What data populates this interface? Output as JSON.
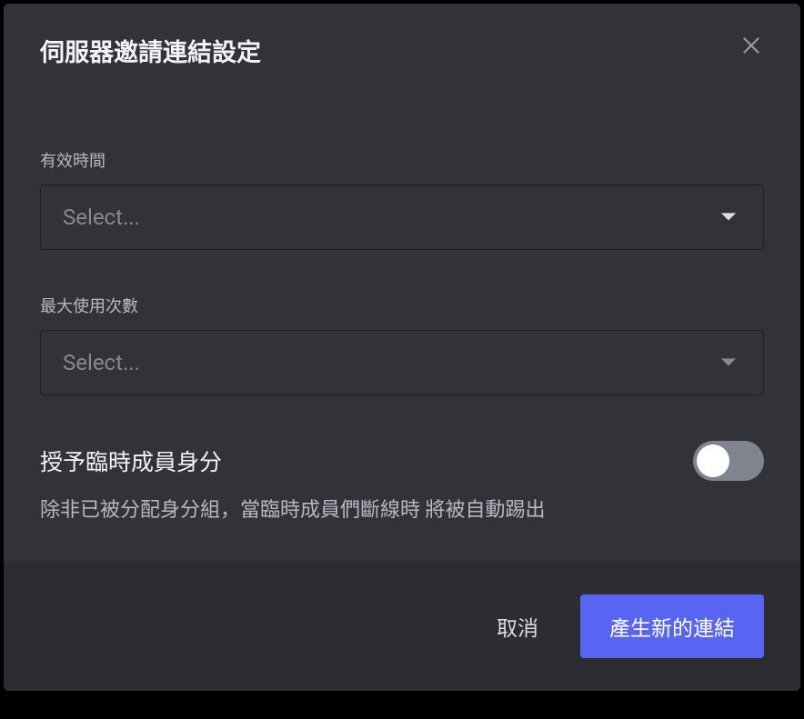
{
  "modal": {
    "title": "伺服器邀請連結設定",
    "fields": {
      "expire": {
        "label": "有效時間",
        "placeholder": "Select..."
      },
      "maxUses": {
        "label": "最大使用次數",
        "placeholder": "Select..."
      }
    },
    "temporary": {
      "label": "授予臨時成員身分",
      "description": "除非已被分配身分組，當臨時成員們斷線時 將被自動踢出",
      "enabled": false
    },
    "actions": {
      "cancel": "取消",
      "generate": "產生新的連結"
    }
  }
}
